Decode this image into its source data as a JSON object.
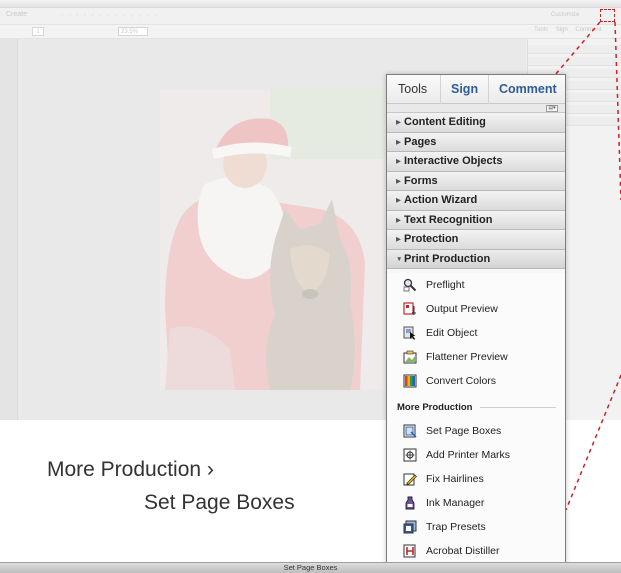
{
  "background_window": {
    "create_label": "Create",
    "customize_label": "Customize",
    "page_number": "1",
    "zoom_level": "23.5%",
    "tabs": [
      "Tools",
      "Sign",
      "Comment"
    ]
  },
  "panel": {
    "tabs": {
      "tools": "Tools",
      "sign": "Sign",
      "comment": "Comment"
    },
    "options_icon": "panel-options-icon",
    "sections": [
      {
        "label": "Content Editing",
        "expanded": false
      },
      {
        "label": "Pages",
        "expanded": false
      },
      {
        "label": "Interactive Objects",
        "expanded": false
      },
      {
        "label": "Forms",
        "expanded": false
      },
      {
        "label": "Action Wizard",
        "expanded": false
      },
      {
        "label": "Text Recognition",
        "expanded": false
      },
      {
        "label": "Protection",
        "expanded": false
      },
      {
        "label": "Print Production",
        "expanded": true
      }
    ],
    "print_production_items": [
      {
        "label": "Preflight",
        "icon": "preflight-icon"
      },
      {
        "label": "Output Preview",
        "icon": "output-preview-icon"
      },
      {
        "label": "Edit Object",
        "icon": "edit-object-icon"
      },
      {
        "label": "Flattener Preview",
        "icon": "flattener-preview-icon"
      },
      {
        "label": "Convert Colors",
        "icon": "convert-colors-icon"
      }
    ],
    "more_production_heading": "More Production",
    "more_production_items": [
      {
        "label": "Set Page Boxes",
        "icon": "set-page-boxes-icon"
      },
      {
        "label": "Add Printer Marks",
        "icon": "add-printer-marks-icon"
      },
      {
        "label": "Fix Hairlines",
        "icon": "fix-hairlines-icon"
      },
      {
        "label": "Ink Manager",
        "icon": "ink-manager-icon"
      },
      {
        "label": "Trap Presets",
        "icon": "trap-presets-icon"
      },
      {
        "label": "Acrobat Distiller",
        "icon": "acrobat-distiller-icon"
      }
    ]
  },
  "caption": {
    "line1": "More Production ›",
    "line2": "Set Page Boxes"
  },
  "bottom_bar": {
    "label": "Set Page Boxes"
  },
  "colors": {
    "callout": "#cc2026",
    "tab_accent": "#2f5c96",
    "panel_border": "#7d7d7d"
  }
}
